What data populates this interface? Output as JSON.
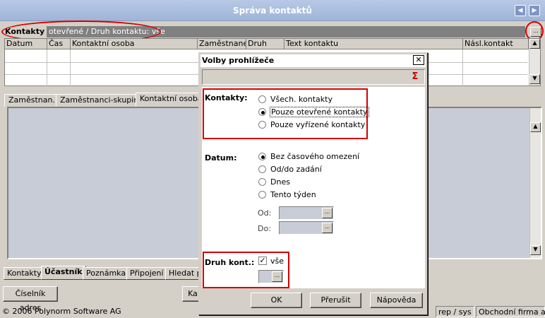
{
  "window": {
    "title": "Správa kontaktů"
  },
  "kontakty": {
    "label": "Kontakty",
    "filter_text": "otevřené / Druh kontaktu: vše",
    "options_button": "..."
  },
  "grid": {
    "columns": [
      "Datum",
      "Čas",
      "Kontaktní osoba",
      "Zaměstnanec",
      "Druh",
      "Text kontaktu",
      "Násl.kontakt"
    ]
  },
  "top_tabs": [
    "Zaměstnan.",
    "Zaměstnanci-skupiny",
    "Kontaktní osoba"
  ],
  "bottom_tabs": [
    "Kontakty",
    "Účastník",
    "Poznámka",
    "Připojení",
    "Hledat p"
  ],
  "buttons": {
    "ciselnik": "Číselník adres",
    "ka": "Ka"
  },
  "status": {
    "copyright": "© 2006 Polynorm Software AG",
    "rep": "rep / sys",
    "firm": "Obchodní firma a.s."
  },
  "dialog": {
    "title": "Volby prohlížeče",
    "close": "✕",
    "kontakty": {
      "label": "Kontakty:",
      "options": [
        "Všech. kontakty",
        "Pouze otevřené kontakty",
        "Pouze vyřízené kontakty"
      ],
      "selected": 1
    },
    "datum": {
      "label": "Datum:",
      "options": [
        "Bez časového omezení",
        "Od/do zadání",
        "Dnes",
        "Tento týden"
      ],
      "selected": 0,
      "od_label": "Od:",
      "do_label": "Do:"
    },
    "druh": {
      "label": "Druh kont.:",
      "checkbox_label": "vše",
      "checked": true
    },
    "ok": "OK",
    "cancel": "Přerušit",
    "help": "Nápověda"
  },
  "colors": {
    "accent_red": "#d40000",
    "title_bar": "#9fb4d8"
  }
}
